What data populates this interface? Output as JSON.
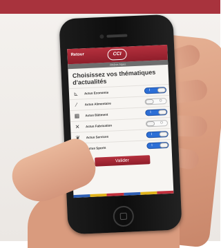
{
  "header": {
    "color": "#a8333d"
  },
  "app": {
    "back_label": "Retour",
    "logo_text": "CCI",
    "region_label": "Rhône-Alpes",
    "title": "Choisissez vos thématiques d'actualités",
    "items": [
      {
        "label": "Actus Economie",
        "icon": "chart-icon",
        "glyph": "⊾",
        "enabled": true,
        "mark": "I"
      },
      {
        "label": "Actus Alimentaire",
        "icon": "knife-icon",
        "glyph": "∕",
        "enabled": false,
        "mark": "O"
      },
      {
        "label": "Actus Bâtiment",
        "icon": "building-icon",
        "glyph": "▦",
        "enabled": true,
        "mark": "I"
      },
      {
        "label": "Actus Fabrication",
        "icon": "tools-icon",
        "glyph": "✕",
        "enabled": false,
        "mark": "O"
      },
      {
        "label": "Actus Services",
        "icon": "handshake-icon",
        "glyph": "❦",
        "enabled": true,
        "mark": "I"
      },
      {
        "label": "Actus Sports",
        "icon": "boot-icon",
        "glyph": "▙",
        "enabled": true,
        "mark": "I"
      }
    ],
    "submit_label": "Valider",
    "accent": "#9c2433",
    "toggle_on_color": "#2d6fd6",
    "stripe_colors": [
      "#2f5fb3",
      "#e0b21a",
      "#c02f3c",
      "#2f5fb3",
      "#e0b21a",
      "#c02f3c"
    ]
  }
}
